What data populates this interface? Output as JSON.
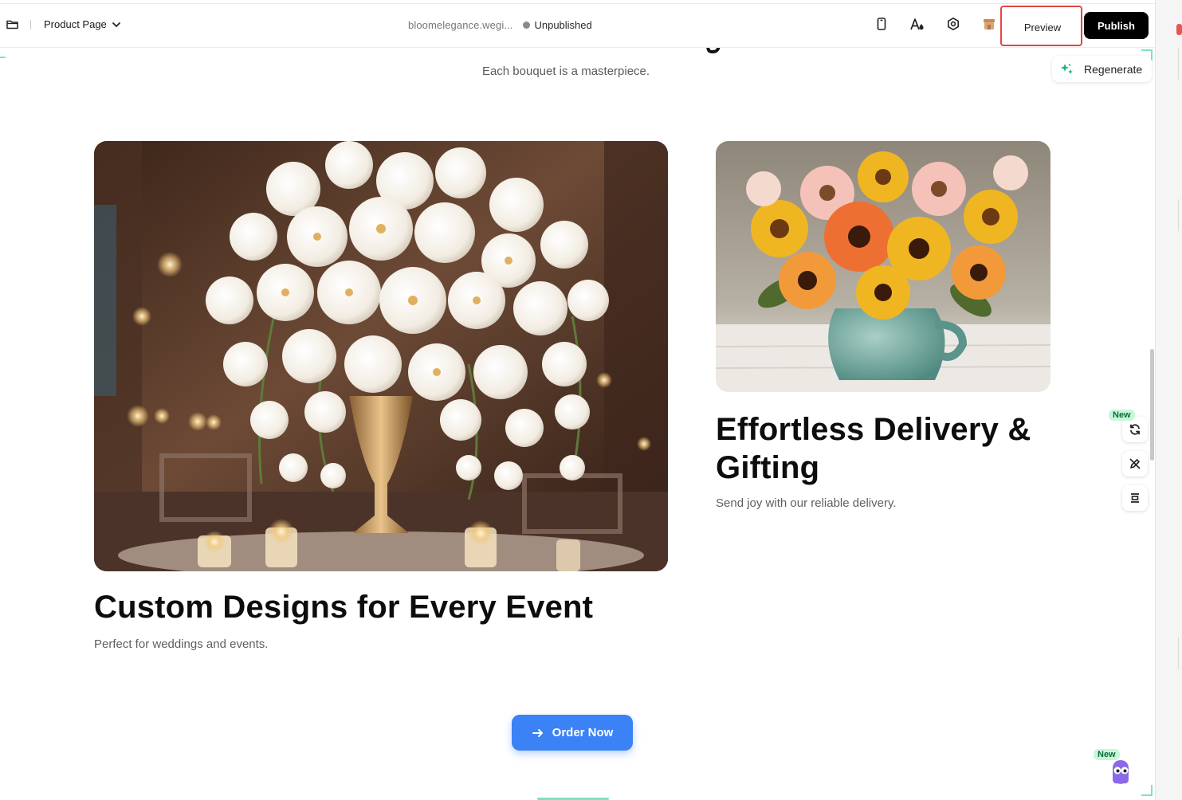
{
  "toolbar": {
    "page_selector_label": "Product Page",
    "domain": "bloomelegance.wegi...",
    "status": "Unpublished",
    "preview_label": "Preview",
    "publish_label": "Publish",
    "icons": [
      "mobile-device-icon",
      "font-style-icon",
      "settings-icon",
      "store-icon"
    ]
  },
  "section": {
    "subtitle": "Each bouquet is a masterpiece.",
    "regenerate_label": "Regenerate"
  },
  "cards": [
    {
      "title": "Custom Designs for Every Event",
      "subtitle": "Perfect for weddings and events.",
      "image": "white-orchid-centerpiece"
    },
    {
      "title": "Effortless Delivery & Gifting",
      "subtitle": "Send joy with our reliable delivery.",
      "image": "gerbera-daisy-bouquet"
    }
  ],
  "cta": {
    "label": "Order Now"
  },
  "side_tools": {
    "badge": "New",
    "icons": [
      "refresh-icon",
      "edit-off-icon",
      "align-center-icon"
    ]
  },
  "assistant": {
    "badge": "New"
  },
  "colors": {
    "accent": "#3b82f6",
    "highlight_border": "#e54545",
    "corner_brackets": "#7ee2bf",
    "publish_bg": "#000000"
  }
}
